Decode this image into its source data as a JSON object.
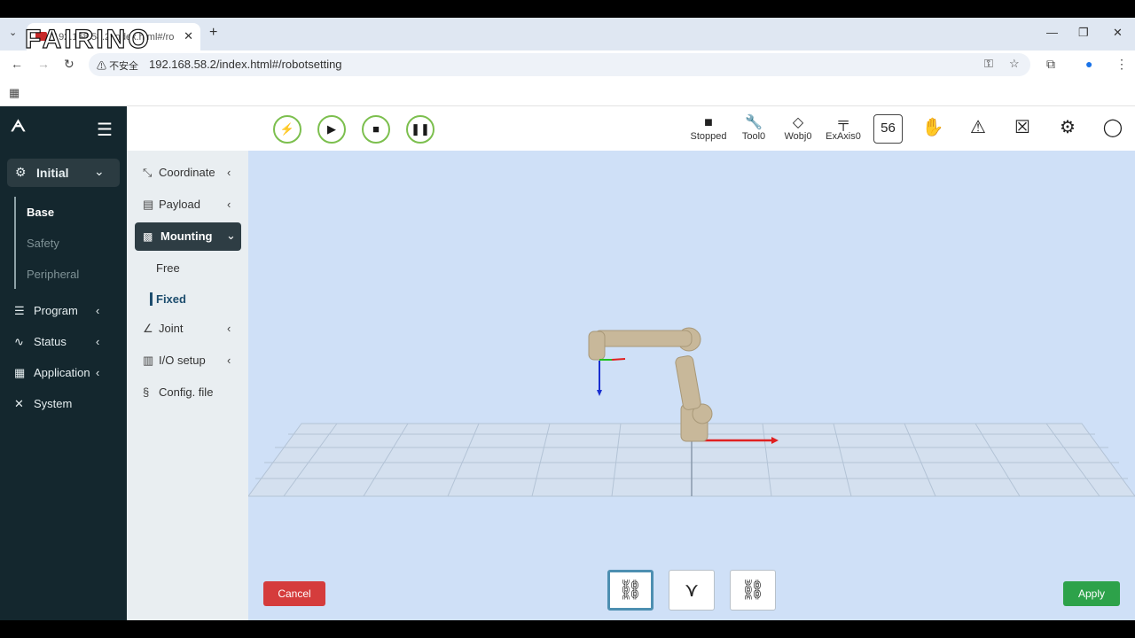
{
  "browser": {
    "tab_title": "192.168.58.2/index.html#/ro",
    "tab_list_icon": "chevron-down",
    "new_tab": "+",
    "overlay_logo": "FAIRINO",
    "insecure_label": "不安全",
    "url": "192.168.58.2/index.html#/robotsetting",
    "window_controls": [
      "—",
      "❐",
      "✕"
    ]
  },
  "sidebar": {
    "logo_icon": "fairino-mark",
    "menu_icon": "☰",
    "initial": {
      "label": "Initial",
      "icon": "gear-icon",
      "chevron": "chevron-down"
    },
    "sub_items": [
      {
        "label": "Base",
        "active": true
      },
      {
        "label": "Safety",
        "active": false
      },
      {
        "label": "Peripheral",
        "active": false
      }
    ],
    "items": [
      {
        "label": "Program",
        "icon": "document-icon"
      },
      {
        "label": "Status",
        "icon": "pulse-icon"
      },
      {
        "label": "Application",
        "icon": "grid-icon"
      },
      {
        "label": "System",
        "icon": "tools-icon"
      }
    ]
  },
  "subnav": {
    "items": [
      {
        "label": "Coordinate",
        "icon": "coordinate-icon"
      },
      {
        "label": "Payload",
        "icon": "payload-icon"
      },
      {
        "label": "Mounting",
        "icon": "mounting-icon"
      },
      {
        "label": "Joint",
        "icon": "joint-icon"
      },
      {
        "label": "I/O setup",
        "icon": "io-icon"
      },
      {
        "label": "Config. file",
        "icon": "config-icon"
      }
    ],
    "mounting_children": [
      {
        "label": "Free",
        "selected": false
      },
      {
        "label": "Fixed",
        "selected": true
      }
    ]
  },
  "topbar": {
    "controls": [
      "power-icon",
      "play-icon",
      "stop-icon",
      "pause-icon"
    ],
    "status": [
      {
        "label": "Stopped",
        "icon": "stop-square-icon"
      },
      {
        "label": "Tool0",
        "icon": "wrench-icon"
      },
      {
        "label": "Wobj0",
        "icon": "eraser-icon"
      },
      {
        "label": "ExAxis0",
        "icon": "exaxis-icon"
      }
    ],
    "speed_value": "56",
    "right_icons": [
      "hand-icon",
      "warning-icon",
      "hand-guide-icon",
      "robot-icon",
      "user-icon"
    ]
  },
  "scene": {
    "view_buttons": [
      "floor-mount-view",
      "wall-mount-view",
      "ceiling-mount-view"
    ],
    "active_view_index": 0
  },
  "actions": {
    "cancel_label": "Cancel",
    "apply_label": "Apply"
  },
  "colors": {
    "sidebar_bg": "#14272e",
    "accent_green": "#7cbf4e",
    "cancel_red": "#d53c3c",
    "apply_green": "#2da24a",
    "viewport_bg": "#cfe0f7"
  }
}
